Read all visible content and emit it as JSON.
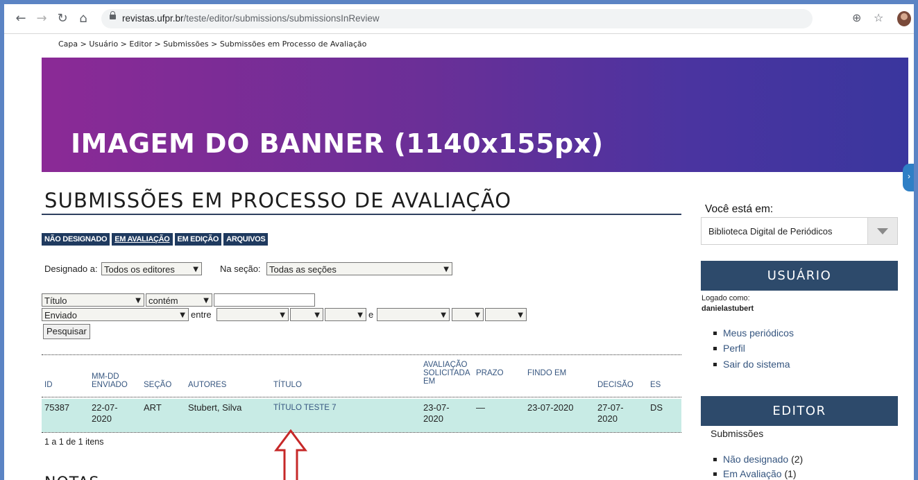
{
  "browser": {
    "url_host": "revistas.ufpr.br",
    "url_path": "/teste/editor/submissions/submissionsInReview"
  },
  "breadcrumb": [
    "Capa",
    "Usuário",
    "Editor",
    "Submissões",
    "Submissões em Processo de Avaliação"
  ],
  "banner": {
    "text": "IMAGEM DO BANNER (1140x155px)"
  },
  "page_title": "SUBMISSÕES EM PROCESSO DE AVALIAÇÃO",
  "tabs": [
    {
      "label": "NÃO DESIGNADO",
      "active": false
    },
    {
      "label": "EM AVALIAÇÃO",
      "active": true
    },
    {
      "label": "EM EDIÇÃO",
      "active": false
    },
    {
      "label": "ARQUIVOS",
      "active": false
    }
  ],
  "filters": {
    "assigned_label": "Designado a:",
    "assigned_value": "Todos os editores",
    "section_label": "Na seção:",
    "section_value": "Todas as seções",
    "search_field": "Título",
    "search_match": "contém",
    "date_field": "Enviado",
    "between_label": "entre",
    "and_label": "e",
    "search_button": "Pesquisar"
  },
  "table": {
    "headers": {
      "id": "ID",
      "submitted": [
        "MM-DD",
        "ENVIADO"
      ],
      "section": "SEÇÃO",
      "authors": "AUTORES",
      "title": "TÍTULO",
      "review_requested": [
        "AVALIAÇÃO",
        "SOLICITADA",
        "EM"
      ],
      "deadline": "PRAZO",
      "done": "FINDO EM",
      "decision": "DECISÃO",
      "es": "ES"
    },
    "rows": [
      {
        "id": "75387",
        "submitted": [
          "22-07-",
          "2020"
        ],
        "section": "ART",
        "authors": "Stubert, Silva",
        "title": "TÍTULO TESTE 7",
        "review_requested": [
          "23-07-",
          "2020"
        ],
        "deadline": "—",
        "done": "23-07-2020",
        "decision": [
          "27-07-",
          "2020"
        ],
        "es": "DS"
      }
    ],
    "count_text": "1 a 1 de 1 itens"
  },
  "notes_heading": "NOTAS",
  "sidebar": {
    "location_label": "Você está em:",
    "location_value": "Biblioteca Digital de Periódicos",
    "user_heading": "USUÁRIO",
    "logged_as_label": "Logado como:",
    "username": "danielastubert",
    "user_links": [
      "Meus periódicos",
      "Perfil",
      "Sair do sistema"
    ],
    "editor_heading": "EDITOR",
    "submissions_label": "Submissões",
    "editor_links": [
      {
        "label": "Não designado",
        "count": "(2)"
      },
      {
        "label": "Em Avaliação",
        "count": "(1)"
      }
    ]
  },
  "colors": {
    "accent_dark_blue": "#2d4a6b",
    "tab_bg": "#1f3a5f",
    "row_highlight": "#c8ebe5",
    "link": "#35557f",
    "annotation_arrow": "#c62828"
  }
}
